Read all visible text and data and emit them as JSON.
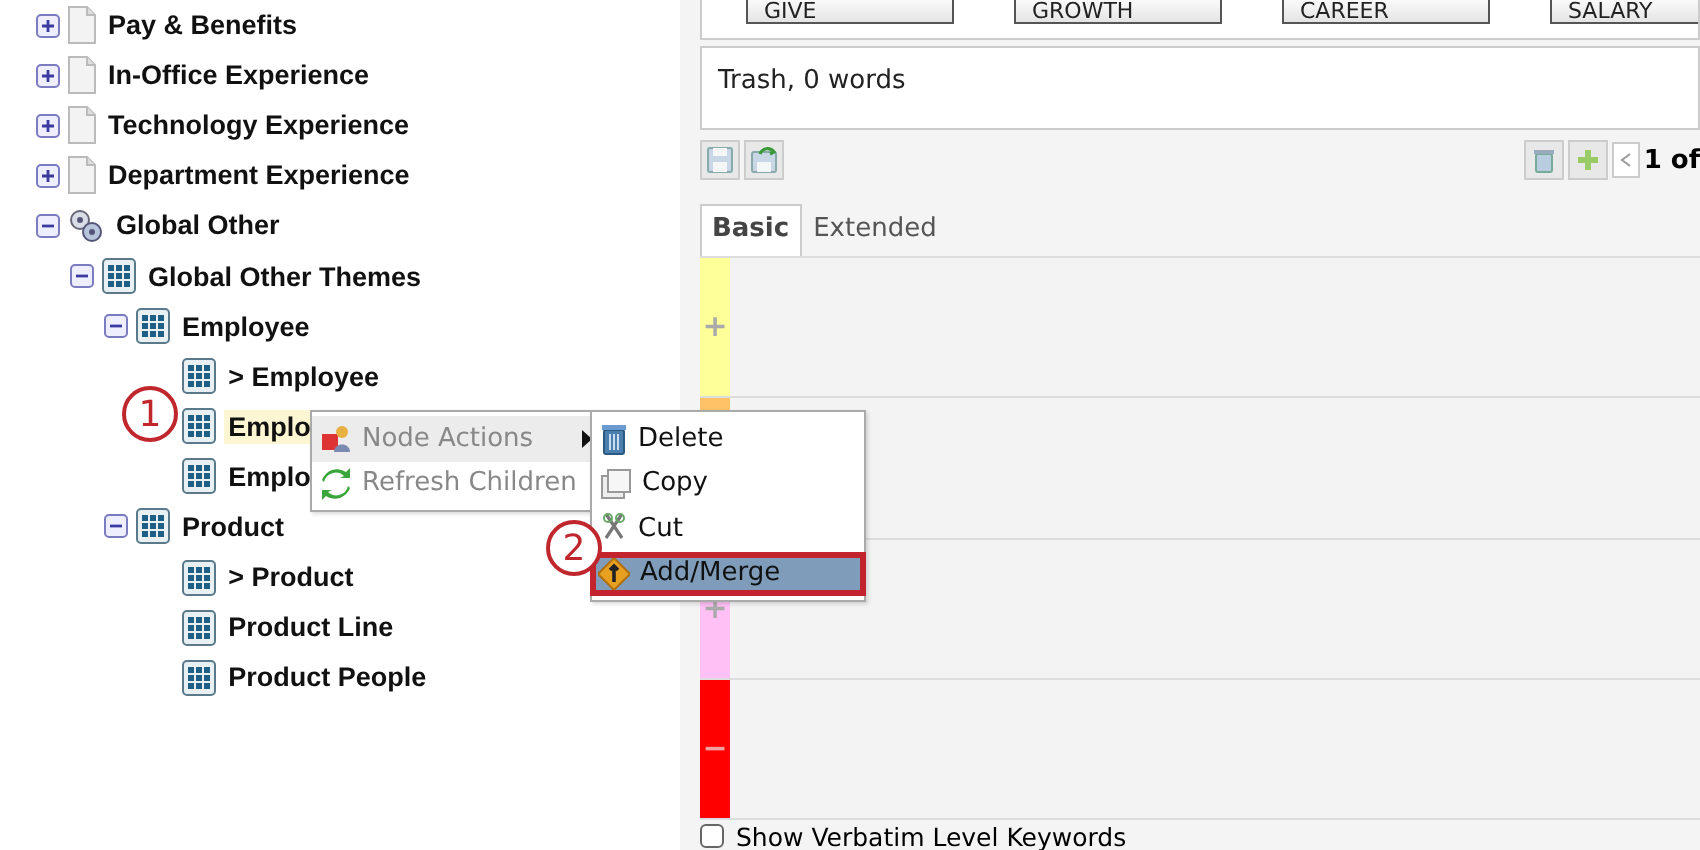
{
  "tree": [
    {
      "label": "Pay & Benefits",
      "kind": "page",
      "expanded": false,
      "selected": false
    },
    {
      "label": "In-Office Experience",
      "kind": "page",
      "expanded": false,
      "selected": false
    },
    {
      "label": "Technology Experience",
      "kind": "page",
      "expanded": false,
      "selected": false
    },
    {
      "label": "Department Experience",
      "kind": "page",
      "expanded": false,
      "selected": false
    },
    {
      "label": "Global Other",
      "kind": "group",
      "expanded": true,
      "selected": false,
      "children": [
        {
          "label": "Global Other Themes",
          "kind": "grid",
          "expanded": true,
          "selected": false,
          "children": [
            {
              "label": "Employee",
              "kind": "grid",
              "expanded": true,
              "selected": false,
              "children": [
                {
                  "label": "> Employee",
                  "kind": "grid",
                  "selected": false
                },
                {
                  "label": "Emplo",
                  "kind": "grid",
                  "selected": true
                },
                {
                  "label": "Emplo",
                  "kind": "grid",
                  "selected": false
                }
              ]
            },
            {
              "label": "Product",
              "kind": "grid",
              "expanded": true,
              "selected": false,
              "children": [
                {
                  "label": "> Product",
                  "kind": "grid",
                  "selected": false
                },
                {
                  "label": "Product Line",
                  "kind": "grid",
                  "selected": false
                },
                {
                  "label": "Product People",
                  "kind": "grid",
                  "selected": false
                }
              ]
            }
          ]
        }
      ]
    }
  ],
  "category_buttons": [
    "GIVE",
    "GROWTH",
    "CAREER",
    "SALARY"
  ],
  "summary": "Trash, 0 words",
  "pager": "1 of",
  "tabs": [
    {
      "label": "Basic",
      "selected": true
    },
    {
      "label": "Extended",
      "selected": false
    }
  ],
  "keyword_rows": [
    {
      "color": "#ffff99",
      "sign": "+"
    },
    {
      "color": "#ffc266"
    },
    {
      "color": "#ffc0f5",
      "sign": "+"
    },
    {
      "color": "#ff0000",
      "sign": "−"
    }
  ],
  "verbatim_checkbox": {
    "label": "Show Verbatim Level Keywords",
    "checked": false
  },
  "context_menu": [
    {
      "label": "Node Actions",
      "disabled": true,
      "selected": true,
      "submenu": true
    },
    {
      "label": "Refresh Children",
      "disabled": true,
      "selected": false
    }
  ],
  "submenu": [
    {
      "label": "Delete",
      "selected": false
    },
    {
      "label": "Copy",
      "selected": false
    },
    {
      "label": "Cut",
      "selected": false
    },
    {
      "label": "Add/Merge",
      "selected": true
    }
  ],
  "callouts": [
    {
      "number": "1"
    },
    {
      "number": "2"
    }
  ]
}
